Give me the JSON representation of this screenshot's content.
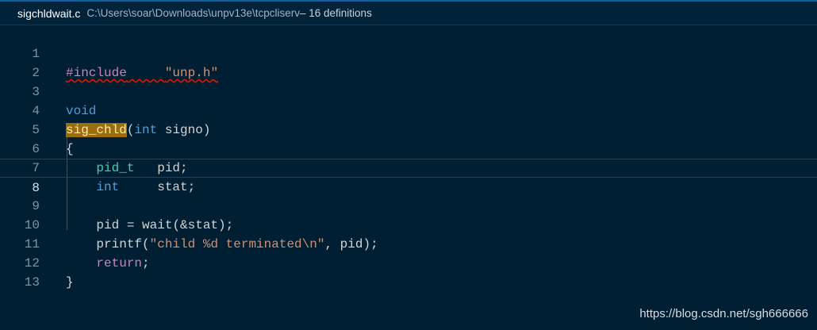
{
  "peek_header": {
    "file_name": "sigchldwait.c",
    "file_path": "C:\\Users\\soar\\Downloads\\unpv13e\\tcpcliserv",
    "definitions_count": " – 16 definitions"
  },
  "editor": {
    "current_line": 8,
    "lines": [
      {
        "number": "1",
        "text": "#include     \"unp.h\""
      },
      {
        "number": "2",
        "text": ""
      },
      {
        "number": "3",
        "text": "void"
      },
      {
        "number": "4",
        "text": "sig_chld(int signo)"
      },
      {
        "number": "5",
        "text": "{"
      },
      {
        "number": "6",
        "text": "    pid_t   pid;"
      },
      {
        "number": "7",
        "text": "    int     stat;"
      },
      {
        "number": "8",
        "text": ""
      },
      {
        "number": "9",
        "text": "    pid = wait(&stat);"
      },
      {
        "number": "10",
        "text": "    printf(\"child %d terminated\\n\", pid);"
      },
      {
        "number": "11",
        "text": "    return;"
      },
      {
        "number": "12",
        "text": "}"
      },
      {
        "number": "13",
        "text": ""
      }
    ]
  },
  "tokens": {
    "l1": {
      "directive": "#include",
      "space": "     ",
      "header": "\"unp.h\""
    },
    "l3": {
      "void_kw": "void"
    },
    "l4": {
      "fn_name": "sig_chld",
      "open": "(",
      "int_kw": "int",
      "param": " signo)"
    },
    "l5": {
      "brace": "{"
    },
    "l6": {
      "indent": "    ",
      "type": "pid_t",
      "rest": "   pid;"
    },
    "l7": {
      "indent": "    ",
      "type": "int",
      "rest": "     stat;"
    },
    "l9": {
      "indent": "    ",
      "var": "pid",
      "eq": " = ",
      "fn": "wait",
      "rest": "(&stat);"
    },
    "l10": {
      "indent": "    ",
      "fn": "printf",
      "open": "(",
      "str_a": "\"child %d terminated",
      "esc": "\\n",
      "str_b": "\"",
      "rest": ", pid);"
    },
    "l11": {
      "indent": "    ",
      "kw": "return",
      "rest": ";"
    },
    "l12": {
      "brace": "}"
    }
  },
  "watermark": "https://blog.csdn.net/sgh666666",
  "colors": {
    "background": "#001f33",
    "header_border": "#0f5fa8",
    "keyword": "#569cd6",
    "type": "#4ec9b0",
    "string": "#ce9178",
    "preprocessor": "#c586c0",
    "highlight": "#9b6d0e",
    "error_squiggle": "#e51400"
  }
}
